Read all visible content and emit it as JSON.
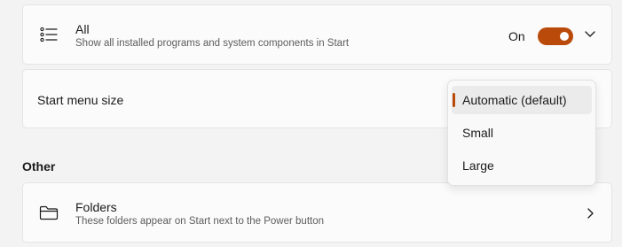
{
  "accent_color": "#b94a0a",
  "all_card": {
    "icon": "list-icon",
    "title": "All",
    "subtitle": "Show all installed programs and system components in Start",
    "toggle_state_label": "On",
    "toggle_on": true,
    "expand_icon": "chevron-down-icon"
  },
  "start_menu_size": {
    "label": "Start menu size",
    "options": [
      "Automatic (default)",
      "Small",
      "Large"
    ],
    "selected_index": 0
  },
  "other_section": {
    "heading": "Other"
  },
  "folders_card": {
    "icon": "folder-icon",
    "title": "Folders",
    "subtitle": "These folders appear on Start next to the Power button",
    "nav_icon": "chevron-right-icon"
  }
}
